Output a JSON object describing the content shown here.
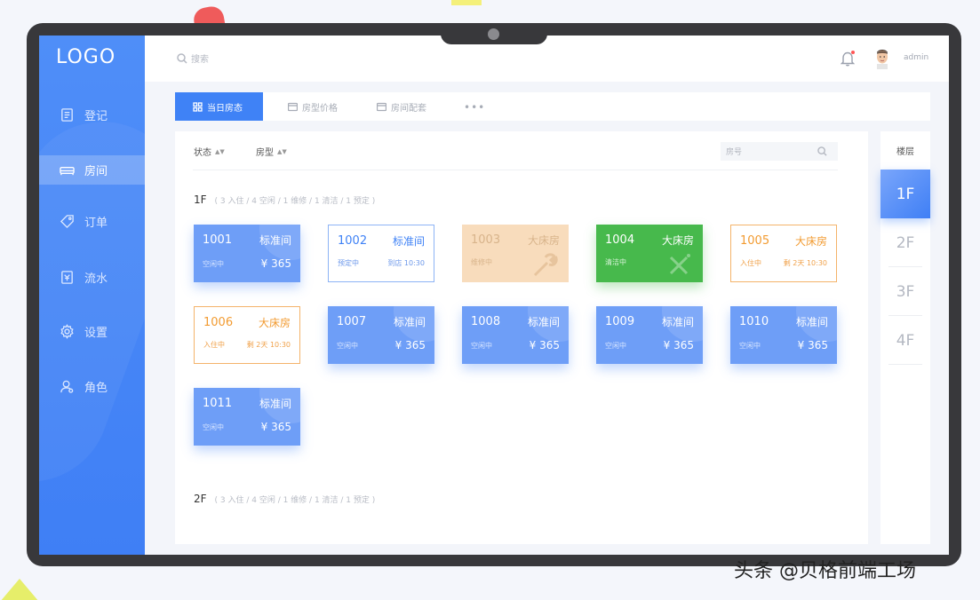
{
  "app": {
    "logo": "LOGO"
  },
  "sidebar": {
    "items": [
      {
        "label": "登记",
        "icon": "register-icon"
      },
      {
        "label": "房间",
        "icon": "bed-icon",
        "active": true
      },
      {
        "label": "订单",
        "icon": "tag-icon"
      },
      {
        "label": "流水",
        "icon": "bill-icon"
      },
      {
        "label": "设置",
        "icon": "gear-icon"
      },
      {
        "label": "角色",
        "icon": "user-icon"
      }
    ]
  },
  "header": {
    "search_placeholder": "搜索",
    "user_name": "admin"
  },
  "tabs": [
    {
      "label": "当日房态",
      "icon": "grid-icon",
      "active": true
    },
    {
      "label": "房型价格",
      "icon": "card-icon"
    },
    {
      "label": "房间配套",
      "icon": "card-icon"
    },
    {
      "label": "•••",
      "icon": "more-icon"
    }
  ],
  "filters": {
    "status_label": "状态",
    "room_type_label": "房型",
    "room_search_placeholder": "房号"
  },
  "floors_panel": {
    "title": "楼层",
    "items": [
      "1F",
      "2F",
      "3F",
      "4F"
    ],
    "active": "1F"
  },
  "floor_sections": [
    {
      "label": "1F",
      "summary": "( 3 入住 / 4 空闲 / 1 维修 / 1 清洁 / 1 预定 )"
    },
    {
      "label": "2F",
      "summary": "( 3 入住 / 4 空闲 / 1 维修 / 1 清洁 / 1 预定 )"
    }
  ],
  "rooms": [
    {
      "number": "1001",
      "type": "标准间",
      "status": "空闲中",
      "info": "¥ 365",
      "state": "vacant"
    },
    {
      "number": "1002",
      "type": "标准间",
      "status": "预定中",
      "info": "到店 10:30",
      "state": "reserved"
    },
    {
      "number": "1003",
      "type": "大床房",
      "status": "维修中",
      "info": "",
      "state": "repair"
    },
    {
      "number": "1004",
      "type": "大床房",
      "status": "清洁中",
      "info": "",
      "state": "clean"
    },
    {
      "number": "1005",
      "type": "大床房",
      "status": "入住中",
      "info": "剩 2天 10:30",
      "state": "occupied"
    },
    {
      "number": "1006",
      "type": "大床房",
      "status": "入住中",
      "info": "剩 2天 10:30",
      "state": "occupied"
    },
    {
      "number": "1007",
      "type": "标准间",
      "status": "空闲中",
      "info": "¥ 365",
      "state": "vacant"
    },
    {
      "number": "1008",
      "type": "标准间",
      "status": "空闲中",
      "info": "¥ 365",
      "state": "vacant"
    },
    {
      "number": "1009",
      "type": "标准间",
      "status": "空闲中",
      "info": "¥ 365",
      "state": "vacant"
    },
    {
      "number": "1010",
      "type": "标准间",
      "status": "空闲中",
      "info": "¥ 365",
      "state": "vacant"
    },
    {
      "number": "1011",
      "type": "标准间",
      "status": "空闲中",
      "info": "¥ 365",
      "state": "vacant"
    }
  ],
  "colors": {
    "primary": "#3f82f6",
    "vacant": "#6e9ef7",
    "reserved_border": "#8db3f5",
    "repair": "#f8dcbc",
    "clean": "#47b94c",
    "occupied": "#f29b31"
  },
  "watermark": "头条 @贝格前端工场"
}
